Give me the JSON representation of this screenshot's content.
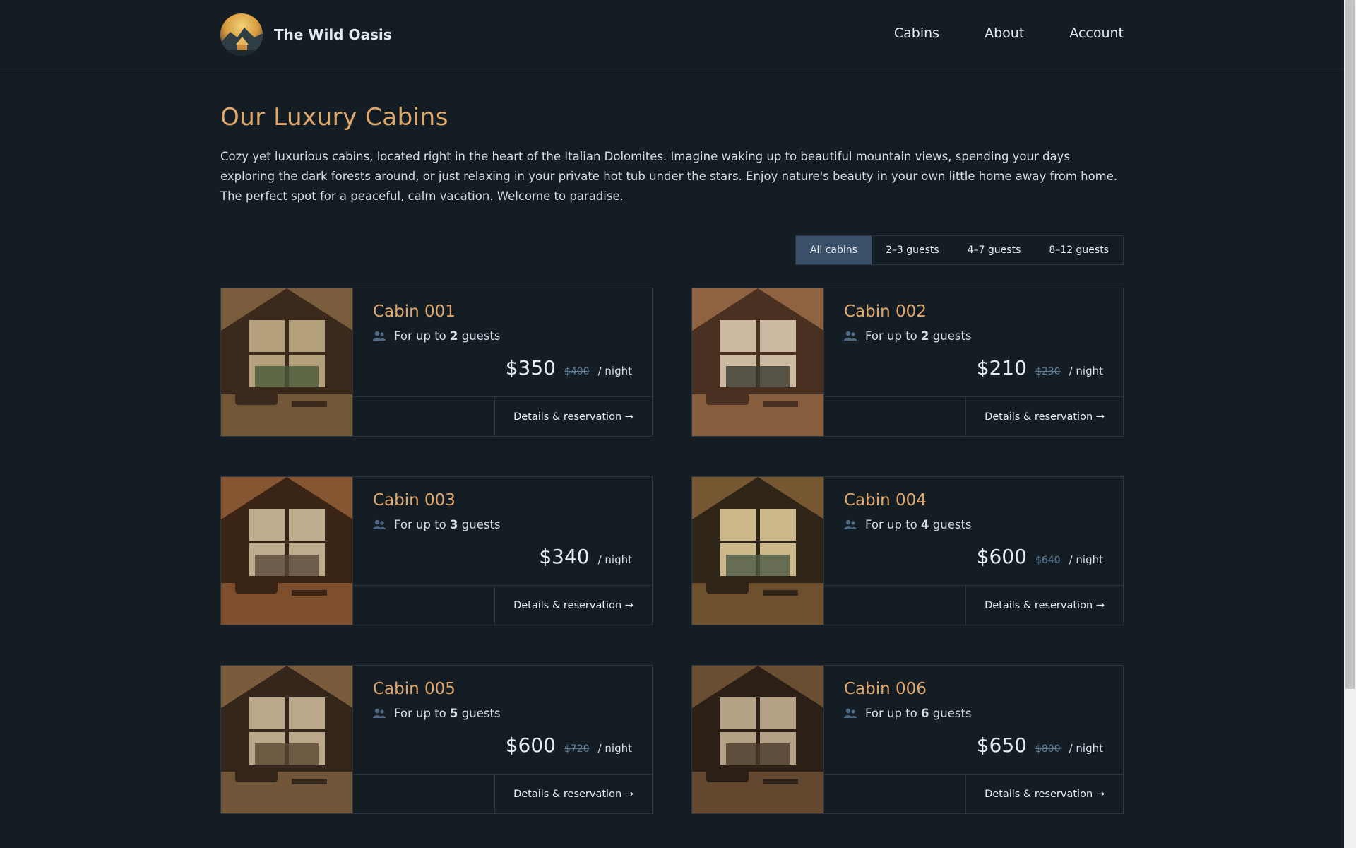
{
  "header": {
    "brand": "The Wild Oasis",
    "nav": [
      {
        "label": "Cabins"
      },
      {
        "label": "About"
      },
      {
        "label": "Account"
      }
    ]
  },
  "main": {
    "title": "Our Luxury Cabins",
    "intro": "Cozy yet luxurious cabins, located right in the heart of the Italian Dolomites. Imagine waking up to beautiful mountain views, spending your days exploring the dark forests around, or just relaxing in your private hot tub under the stars. Enjoy nature's beauty in your own little home away from home. The perfect spot for a peaceful, calm vacation. Welcome to paradise.",
    "filters": [
      {
        "label": "All cabins",
        "active": true
      },
      {
        "label": "2–3 guests",
        "active": false
      },
      {
        "label": "4–7 guests",
        "active": false
      },
      {
        "label": "8–12 guests",
        "active": false
      }
    ],
    "guests_prefix": "For up to",
    "guests_suffix": "guests",
    "per_night": "/ night",
    "details_label": "Details & reservation →",
    "cabins": [
      {
        "name": "Cabin 001",
        "guests": "2",
        "price": "$350",
        "old_price": "$400"
      },
      {
        "name": "Cabin 002",
        "guests": "2",
        "price": "$210",
        "old_price": "$230"
      },
      {
        "name": "Cabin 003",
        "guests": "3",
        "price": "$340",
        "old_price": ""
      },
      {
        "name": "Cabin 004",
        "guests": "4",
        "price": "$600",
        "old_price": "$640"
      },
      {
        "name": "Cabin 005",
        "guests": "5",
        "price": "$600",
        "old_price": "$720"
      },
      {
        "name": "Cabin 006",
        "guests": "6",
        "price": "$650",
        "old_price": "$800"
      }
    ]
  },
  "colors": {
    "background": "#141c24",
    "accent": "#e0a76a",
    "active_filter": "#3a5068",
    "border": "#2a3642"
  }
}
